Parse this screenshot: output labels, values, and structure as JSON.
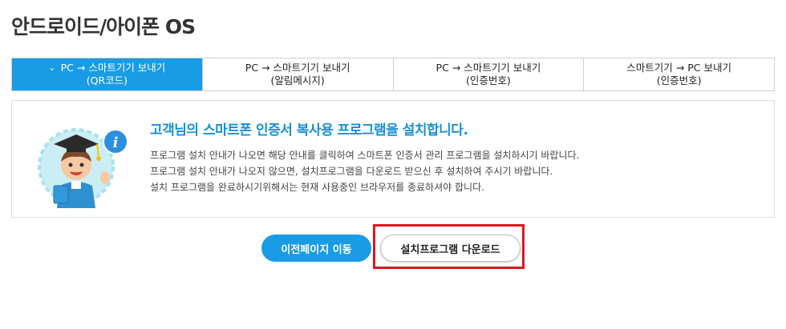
{
  "page": {
    "title": "안드로이드/아이폰 OS"
  },
  "tabs": [
    {
      "line1": "PC → 스마트기기 보내기",
      "line2": "(QR코드)",
      "active": true
    },
    {
      "line1": "PC → 스마트기기 보내기",
      "line2": "(알림메시지)",
      "active": false
    },
    {
      "line1": "PC → 스마트기기 보내기",
      "line2": "(인증번호)",
      "active": false
    },
    {
      "line1": "스마트기기 → PC 보내기",
      "line2": "(인증번호)",
      "active": false
    }
  ],
  "info": {
    "title": "고객님의 스마트폰 인증서 복사용 프로그램을 설치합니다.",
    "lines": [
      "프로그램 설치 안내가 나오면 해당 안내를 클릭하여 스마트폰 인증서 관리 프로그램을 설치하시기 바랍니다.",
      "프로그램 설치 안내가 나오지 않으면, 설치프로그램을 다운로드 받으신 후 설치하여 주시기 바랍니다.",
      "설치 프로그램을 완료하시기위해서는 현재 사용중인 브라우저를 종료하셔야 합니다."
    ]
  },
  "buttons": {
    "prev": "이전페이지 이동",
    "download": "설치프로그램 다운로드"
  },
  "icons": {
    "active_tab": "chevron-down-icon",
    "illustration": "graduate-character-icon",
    "badge": "info-icon"
  },
  "colors": {
    "accent": "#1a9be6",
    "title_blue": "#1a8fd6",
    "highlight_red": "#e0161f"
  }
}
